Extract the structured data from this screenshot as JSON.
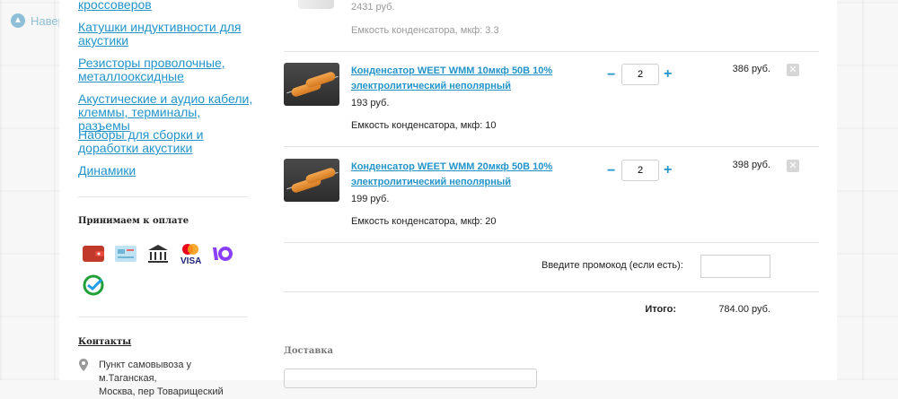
{
  "back_to_top": {
    "label": "Наверх"
  },
  "sidebar": {
    "categories": [
      {
        "label": "кроссоверов"
      },
      {
        "label": "Катушки индуктивности для акустики"
      },
      {
        "label": "Резисторы проволочные, металлооксидные"
      },
      {
        "label": "Акустические и аудио кабели, клеммы, терминалы, разъемы"
      },
      {
        "label": "Наборы для сборки и доработки акустики"
      },
      {
        "label": "Динамики"
      }
    ],
    "payment": {
      "heading": "Принимаем к оплате",
      "icons": [
        "wallet-icon",
        "card-icon",
        "bank-icon",
        "mastercard-visa-icon",
        "yoomoney-icon",
        "sberbank-icon"
      ]
    },
    "contacts": {
      "heading": "Контакты",
      "pickup_line1": "Пункт самовывоза у м.Таганская,",
      "pickup_line2": "Москва, пер Товарищеский"
    }
  },
  "cart": {
    "partial_item": {
      "unit_price": "2431 руб.",
      "prop": "Емкость конденсатора, мкф: 3.3"
    },
    "items": [
      {
        "name": "Конденсатор WEET WMM 10мкф 50В 10% электролитический неполярный",
        "unit_price": "193 руб.",
        "prop": "Емкость конденсатора, мкф: 10",
        "quantity": "2",
        "line_total": "386 руб."
      },
      {
        "name": "Конденсатор WEET WMM 20мкф 50В 10% электролитический неполярный",
        "unit_price": "199 руб.",
        "prop": "Емкость конденсатора, мкф: 20",
        "quantity": "2",
        "line_total": "398 руб."
      }
    ],
    "qty_minus": "−",
    "qty_plus": "+",
    "remove_symbol": "✕",
    "promo_label": "Введите промокод (если есть):",
    "promo_value": "",
    "total_label": "Итого:",
    "total_value": "784.00 руб.",
    "delivery_heading": "Доставка"
  },
  "colors": {
    "link": "#2394c9",
    "muted": "#999999",
    "accent_bg": "#ffffff"
  }
}
